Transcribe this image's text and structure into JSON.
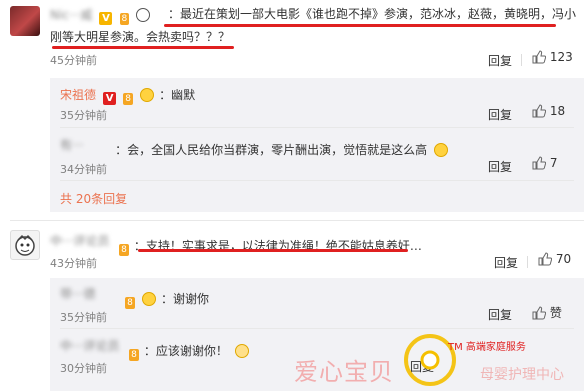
{
  "comment1": {
    "user": "Nic···威",
    "text_line1": "：最近在策划一部大电影《谁也跑不掉》参演，范冰冰，赵薇，黄晓明，冯小",
    "text_line2": "刚等大明星参演。会热卖吗？？？",
    "time": "45分钟前",
    "reply_label": "回复",
    "likes": "123"
  },
  "reply1": {
    "user": "宋祖德",
    "text": "：幽默",
    "time": "35分钟前",
    "reply_label": "回复",
    "likes": "18"
  },
  "reply2": {
    "user": "有···",
    "text": "：会，全国人民给你当群演，零片酬出演，觉悟就是这么高",
    "time": "34分钟前",
    "reply_label": "回复",
    "likes": "7"
  },
  "more_replies": "共 20条回复",
  "comment2": {
    "user": "中···评论员",
    "text": "：支持！实事求是，以法律为准绳！绝不能姑息养奸…",
    "time": "43分钟前",
    "reply_label": "回复",
    "likes": "70"
  },
  "reply3": {
    "user": "带···德",
    "text": "：谢谢你",
    "time": "35分钟前",
    "reply_label": "回复",
    "likes": "赞"
  },
  "reply4": {
    "user": "中···评论员",
    "text": "：应该谢谢你！",
    "time": "30分钟前",
    "reply_label": "回复"
  },
  "watermark": {
    "brand_cn": "爱心宝贝",
    "tm_text": "TM 高端家庭服务",
    "slogan": "母婴护理中心"
  },
  "colors": {
    "username": "#eb7350",
    "underline": "#e02020",
    "sub_background": "#f2f2f5",
    "watermark": "#f0a0a0"
  }
}
